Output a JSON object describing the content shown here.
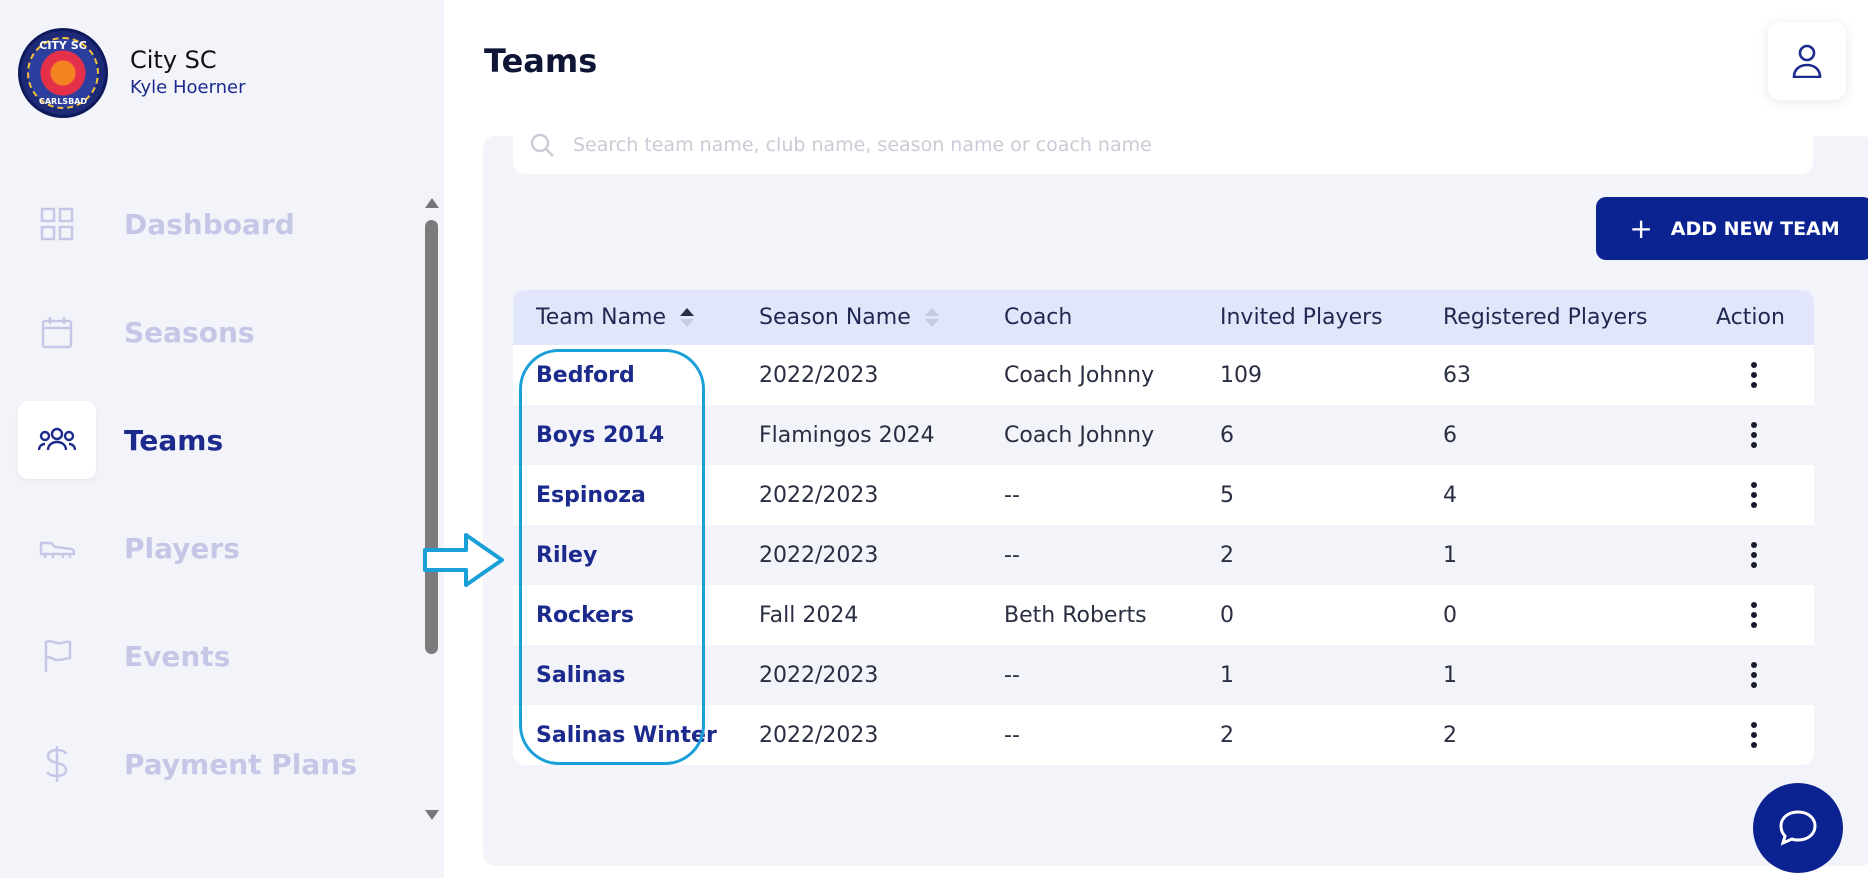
{
  "brand": {
    "club_name": "City SC",
    "user_name": "Kyle Hoerner",
    "logo_top_text": "CITY SC",
    "logo_bottom_text": "CARLSBAD"
  },
  "sidebar": {
    "items": [
      {
        "label": "Dashboard",
        "icon": "grid-icon",
        "active": false
      },
      {
        "label": "Seasons",
        "icon": "calendar-icon",
        "active": false
      },
      {
        "label": "Teams",
        "icon": "people-icon",
        "active": true
      },
      {
        "label": "Players",
        "icon": "cleat-icon",
        "active": false
      },
      {
        "label": "Events",
        "icon": "flag-icon",
        "active": false
      },
      {
        "label": "Payment Plans",
        "icon": "dollar-icon",
        "active": false
      }
    ]
  },
  "header": {
    "title": "Teams"
  },
  "search": {
    "placeholder": "Search team name, club name, season name or coach name"
  },
  "toolbar": {
    "add_label": "ADD NEW TEAM"
  },
  "table": {
    "columns": [
      "Team Name",
      "Season Name",
      "Coach",
      "Invited Players",
      "Registered Players",
      "Action"
    ],
    "rows": [
      {
        "team": "Bedford",
        "season": "2022/2023",
        "coach": "Coach Johnny",
        "invited": "109",
        "registered": "63"
      },
      {
        "team": "Boys 2014",
        "season": "Flamingos 2024",
        "coach": "Coach Johnny",
        "invited": "6",
        "registered": "6"
      },
      {
        "team": "Espinoza",
        "season": "2022/2023",
        "coach": "--",
        "invited": "5",
        "registered": "4"
      },
      {
        "team": "Riley",
        "season": "2022/2023",
        "coach": "--",
        "invited": "2",
        "registered": "1"
      },
      {
        "team": "Rockers",
        "season": "Fall 2024",
        "coach": "Beth Roberts",
        "invited": "0",
        "registered": "0"
      },
      {
        "team": "Salinas",
        "season": "2022/2023",
        "coach": "--",
        "invited": "1",
        "registered": "1"
      },
      {
        "team": "Salinas Winter",
        "season": "2022/2023",
        "coach": "--",
        "invited": "2",
        "registered": "2"
      }
    ]
  },
  "colors": {
    "primary": "#0b2391",
    "active_text": "#1b2a8c",
    "inactive_nav": "#c4c8e6",
    "header_row": "#e2e6fb",
    "annotation": "#1aa0d8"
  }
}
